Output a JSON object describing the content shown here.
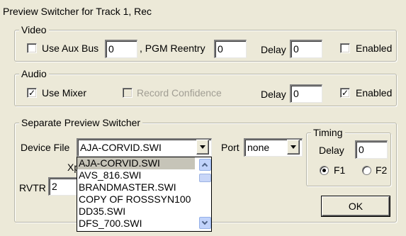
{
  "window_title": "Preview Switcher for Track 1, Rec",
  "video": {
    "legend": "Video",
    "use_aux_bus_label": "Use Aux Bus",
    "use_aux_bus_checked": false,
    "aux_bus_value": "0",
    "pgm_reentry_label": ", PGM Reentry",
    "pgm_reentry_value": "0",
    "delay_label": "Delay",
    "delay_value": "0",
    "enabled_label": "Enabled",
    "enabled_checked": false
  },
  "audio": {
    "legend": "Audio",
    "use_mixer_label": "Use Mixer",
    "use_mixer_checked": true,
    "record_confidence_label": "Record Confidence",
    "record_confidence_checked": false,
    "delay_label": "Delay",
    "delay_value": "0",
    "enabled_label": "Enabled",
    "enabled_checked": true
  },
  "separate": {
    "legend": "Separate Preview Switcher",
    "device_file_label": "Device File",
    "device_file_value": "AJA-CORVID.SWI",
    "port_label": "Port",
    "port_value": "none",
    "xp_label": "Xp",
    "rvtr_label": "RVTR",
    "rvtr_value": "2",
    "device_file_options": [
      "AJA-CORVID.SWI",
      "AVS_816.SWI",
      "BRANDMASTER.SWI",
      "COPY OF ROSSSYN100",
      "DD35.SWI",
      "DFS_700.SWI"
    ],
    "selected_option": "AJA-CORVID.SWI"
  },
  "timing": {
    "legend": "Timing",
    "delay_label": "Delay",
    "delay_value": "0",
    "f1_label": "F1",
    "f2_label": "F2",
    "selected": "F1"
  },
  "ok_label": "OK"
}
